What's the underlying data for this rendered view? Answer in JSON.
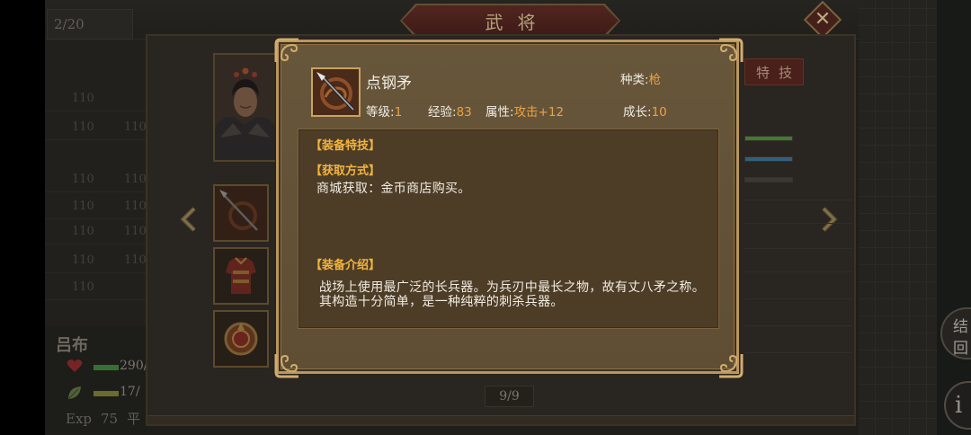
{
  "scene": {
    "title": "武将",
    "counter": "2/20",
    "page_indicator": "9/9",
    "skill_tab": "特技",
    "left_list": [
      {
        "left": "110"
      },
      {
        "left": "110",
        "right": "110"
      },
      {
        "left": "110",
        "right": "110"
      },
      {
        "left": "110",
        "right": "110"
      },
      {
        "left": "110",
        "right": "110"
      },
      {
        "left": "110",
        "right": "110"
      },
      {
        "left": "110"
      }
    ],
    "general": {
      "name": "吕布",
      "hp_text": "290/",
      "mp_text": "17/",
      "exp_label": "Exp",
      "exp_value": "75",
      "exp_suffix": "平"
    },
    "side_buttons": {
      "end_turn_top": "结",
      "end_turn_bottom": "回",
      "info": "i"
    }
  },
  "modal": {
    "item_name": "点钢矛",
    "type": {
      "label": "种类:",
      "value": "枪"
    },
    "stats": [
      {
        "label": "等级:",
        "value": "1"
      },
      {
        "label": "经验:",
        "value": "83"
      },
      {
        "label": "属性:",
        "value": "攻击+12"
      },
      {
        "label": "成长:",
        "value": "10"
      }
    ],
    "skill_title": "【装备特技】",
    "source_title": "【获取方式】",
    "source_text": "商城获取：金币商店购买。",
    "intro_title": "【装备介绍】",
    "intro_lines": [
      "战场上使用最广泛的长兵器。为兵刃中最长之物，故有丈八矛之称。",
      "其构造十分简单，是一种纯粹的刺杀兵器。"
    ]
  },
  "icons": {
    "close": "close-icon",
    "prev": "chevron-left-icon",
    "next": "chevron-right-icon",
    "item": "spear-icon",
    "hp": "heart-icon",
    "mp": "leaf-icon",
    "info": "info-icon"
  },
  "colors": {
    "accent_gold": "#f2b441",
    "value_orange": "#eaa246",
    "text_light": "#f1ece2",
    "modal_bg": "#645337",
    "modal_inner": "#4d3d27",
    "modal_border": "#b8965f",
    "hp_green": "#3f7f3a",
    "heart_red": "#8a2a2a"
  }
}
